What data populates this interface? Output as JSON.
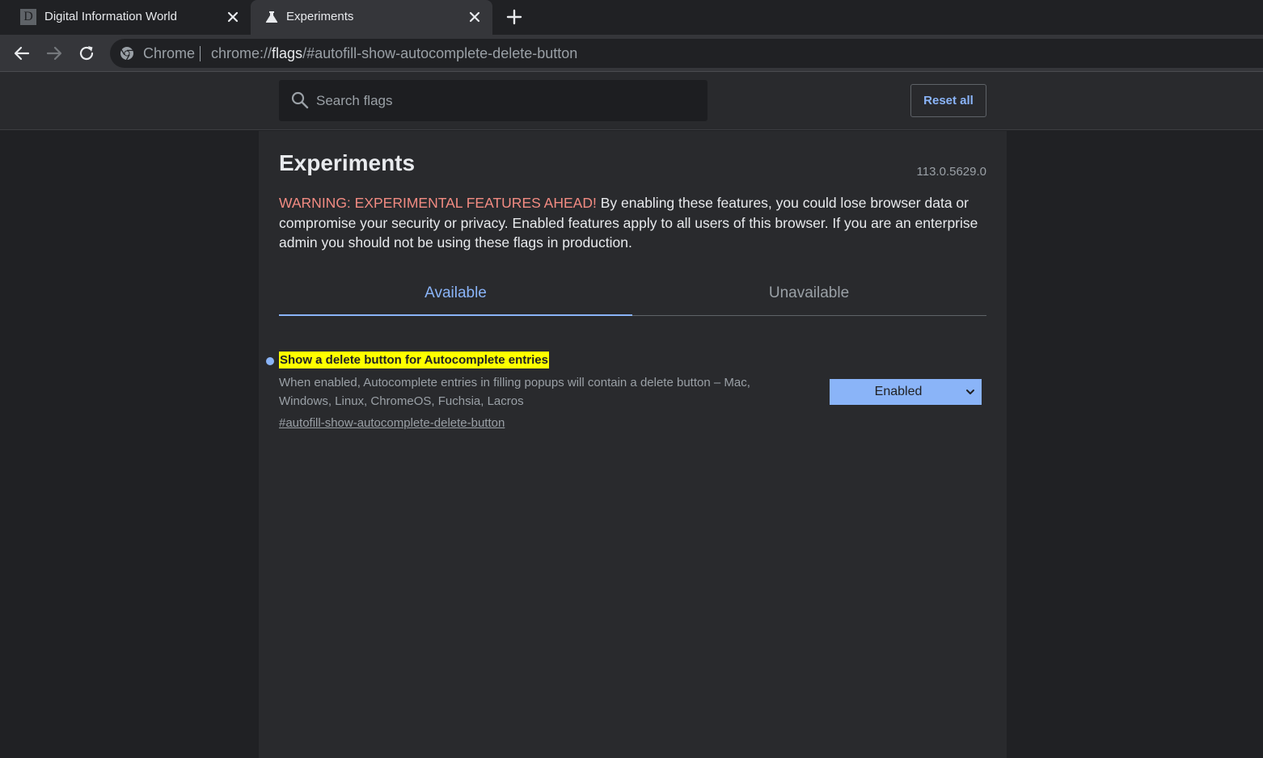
{
  "browser": {
    "tabs": [
      {
        "title": "Digital Information World",
        "favicon": "D",
        "active": false
      },
      {
        "title": "Experiments",
        "favicon": "flask-icon",
        "active": true
      }
    ],
    "omnibox": {
      "label": "Chrome",
      "url_scheme": "chrome://",
      "url_host": "flags",
      "url_path": "/#autofill-show-autocomplete-delete-button"
    }
  },
  "header": {
    "search_placeholder": "Search flags",
    "reset_label": "Reset all"
  },
  "main": {
    "title": "Experiments",
    "version": "113.0.5629.0",
    "warning_strong": "WARNING: EXPERIMENTAL FEATURES AHEAD!",
    "warning_text": " By enabling these features, you could lose browser data or compromise your security or privacy. Enabled features apply to all users of this browser. If you are an enterprise admin you should not be using these flags in production.",
    "tabs": [
      {
        "label": "Available",
        "selected": true
      },
      {
        "label": "Unavailable",
        "selected": false
      }
    ],
    "flag": {
      "name": "Show a delete button for Autocomplete entries",
      "description": "When enabled, Autocomplete entries in filling popups will contain a delete button – Mac, Windows, Linux, ChromeOS, Fuchsia, Lacros",
      "link": "#autofill-show-autocomplete-delete-button",
      "selected": "Enabled"
    }
  },
  "colors": {
    "accent": "#8ab4f8",
    "warning": "#f28b82",
    "highlight": "#ffff00",
    "background": "#202124"
  }
}
